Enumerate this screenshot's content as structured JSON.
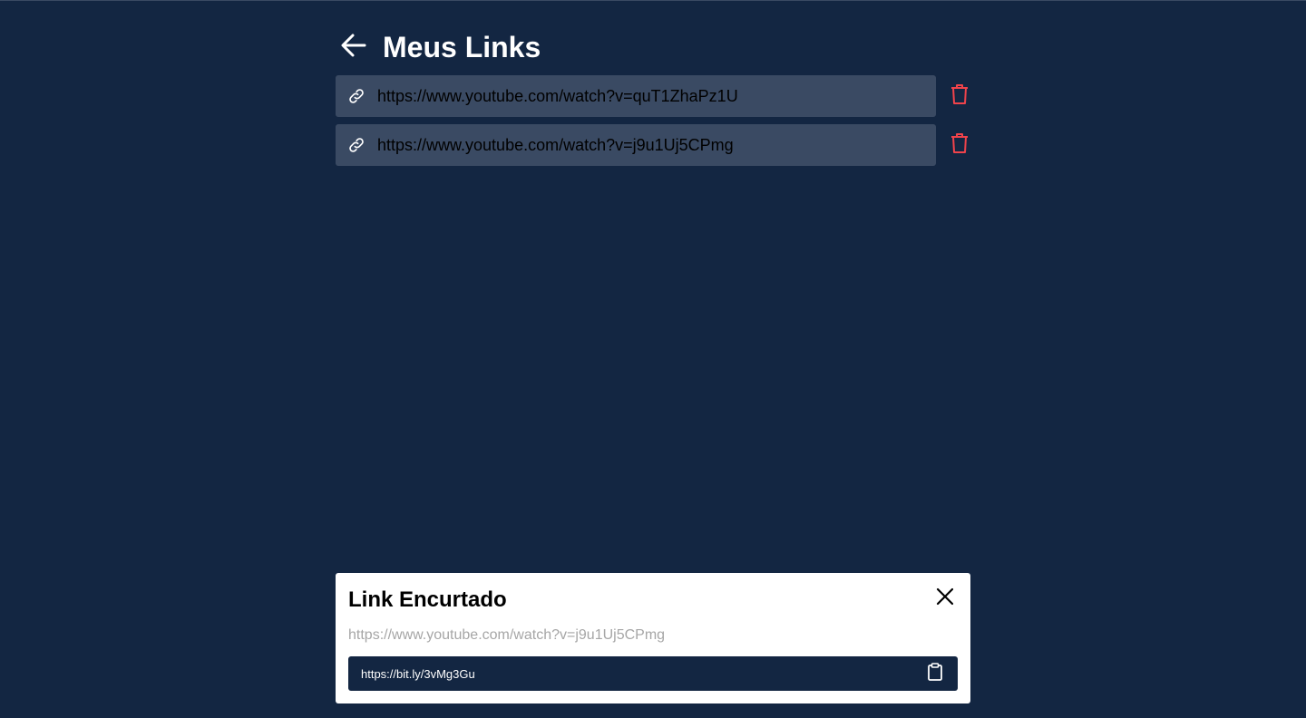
{
  "header": {
    "back_icon": "arrow-left-icon",
    "title": "Meus Links"
  },
  "links": [
    {
      "url": "https://www.youtube.com/watch?v=quT1ZhaPz1U",
      "icon": "link-icon",
      "delete_icon": "trash-icon"
    },
    {
      "url": "https://www.youtube.com/watch?v=j9u1Uj5CPmg",
      "icon": "link-icon",
      "delete_icon": "trash-icon"
    }
  ],
  "modal": {
    "title": "Link Encurtado",
    "close_icon": "close-icon",
    "original_url": "https://www.youtube.com/watch?v=j9u1Uj5CPmg",
    "short_url": "https://bit.ly/3vMg3Gu",
    "copy_icon": "clipboard-icon"
  },
  "colors": {
    "background": "#132642",
    "item_background": "#3a4a63",
    "delete_icon": "#f0434b",
    "modal_background": "#ffffff"
  }
}
